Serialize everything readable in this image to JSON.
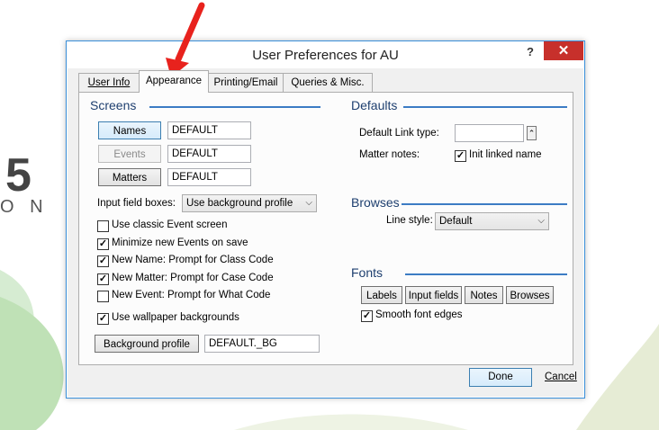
{
  "background": {
    "partial_digit": "5",
    "partial_letters": "O N"
  },
  "dialog": {
    "title": "User Preferences for AU",
    "help_label": "?",
    "close_label": "✕"
  },
  "tabs": [
    {
      "label": "User Info",
      "active": false
    },
    {
      "label": "Appearance",
      "active": true
    },
    {
      "label": "Printing/Email",
      "active": false
    },
    {
      "label": "Queries & Misc.",
      "active": false
    }
  ],
  "screens": {
    "title": "Screens",
    "names_button": "Names",
    "names_value": "DEFAULT",
    "events_button": "Events",
    "events_value": "DEFAULT",
    "matters_button": "Matters",
    "matters_value": "DEFAULT",
    "input_field_boxes_label": "Input field boxes:",
    "input_field_boxes_value": "Use background profile",
    "checkboxes": [
      {
        "label": "Use classic Event screen",
        "checked": false
      },
      {
        "label": "Minimize new Events on save",
        "checked": true
      },
      {
        "label": "New Name: Prompt for Class Code",
        "checked": true
      },
      {
        "label": "New Matter: Prompt for Case Code",
        "checked": true
      },
      {
        "label": "New Event: Prompt for What Code",
        "checked": false
      }
    ],
    "wallpaper": {
      "label": "Use wallpaper backgrounds",
      "checked": true
    },
    "background_profile_button": "Background profile",
    "background_profile_value": "DEFAULT._BG"
  },
  "defaults": {
    "title": "Defaults",
    "link_type_label": "Default Link type:",
    "link_type_value": "",
    "matter_notes_label": "Matter notes:",
    "init_linked": {
      "label": "Init linked name",
      "checked": true
    }
  },
  "browses": {
    "title": "Browses",
    "line_style_label": "Line style:",
    "line_style_value": "Default"
  },
  "fonts": {
    "title": "Fonts",
    "buttons": [
      "Labels",
      "Input fields",
      "Notes",
      "Browses"
    ],
    "smooth": {
      "label": "Smooth font edges",
      "checked": true
    }
  },
  "footer": {
    "done_label": "Done",
    "cancel_label": "Cancel"
  },
  "colors": {
    "accent": "#3c7cc4",
    "close_red": "#c7302b",
    "arrow_red": "#e8221d"
  }
}
